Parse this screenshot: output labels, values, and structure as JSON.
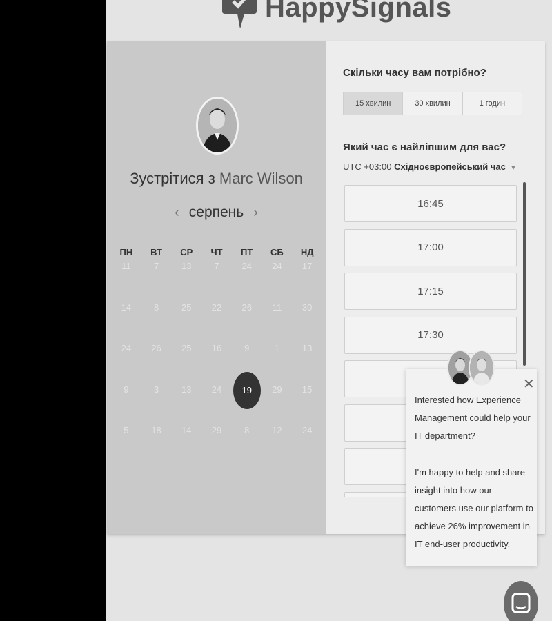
{
  "brand": {
    "name": "HappySignals"
  },
  "scheduler": {
    "meet_prefix": "Зустрітися з",
    "host_name": "Marc Wilson",
    "month": "серпень",
    "prev_icon": "chevron-left-icon",
    "next_icon": "chevron-right-icon",
    "weekdays": [
      "ПН",
      "ВТ",
      "СР",
      "ЧТ",
      "ПТ",
      "СБ",
      "НД"
    ],
    "weeks": [
      [
        "11",
        "7",
        "13",
        "7",
        "24",
        "24",
        "17"
      ],
      [
        "14",
        "8",
        "25",
        "22",
        "26",
        "11",
        "30"
      ],
      [
        "24",
        "26",
        "25",
        "16",
        "9",
        "1",
        "13"
      ],
      [
        "9",
        "3",
        "13",
        "24",
        "19",
        "29",
        "15"
      ],
      [
        "5",
        "18",
        "14",
        "29",
        "8",
        "12",
        "24"
      ]
    ],
    "selected_day": "19",
    "duration_question": "Скільки часу вам потрібно?",
    "durations": [
      "15 хвилин",
      "30 хвилин",
      "1 годин"
    ],
    "selected_duration": "15 хвилин",
    "time_question": "Який час є найліпшим для вас?",
    "timezone_offset": "UTC +03:00",
    "timezone_name": "Східноєвропейський час",
    "time_slots": [
      "16:45",
      "17:00",
      "17:15",
      "17:30",
      "",
      "",
      "",
      ""
    ]
  },
  "chat_popup": {
    "message_1": "Interested how Experience Management could help your IT department?",
    "message_2": "I'm happy to help and share insight into how our customers use our platform to achieve 26% improvement in IT end-user productivity.",
    "close_icon": "close-icon",
    "launcher_icon": "chat-bubble-icon"
  },
  "colors": {
    "panel_left": "#c9c9c9",
    "selected_day": "#333333",
    "page_bg": "#e4e4e4"
  }
}
